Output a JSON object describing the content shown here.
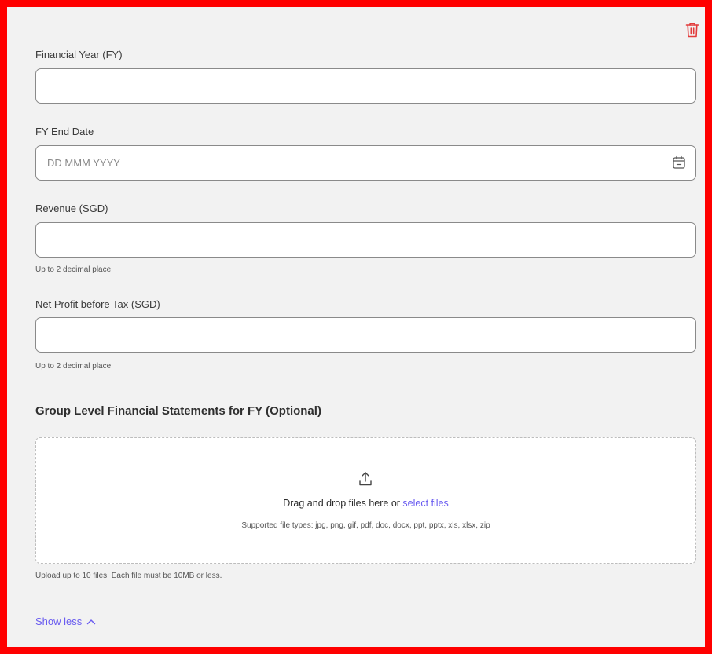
{
  "form": {
    "financial_year": {
      "label": "Financial Year (FY)",
      "value": "",
      "placeholder": ""
    },
    "fy_end_date": {
      "label": "FY End Date",
      "value": "",
      "placeholder": "DD MMM YYYY"
    },
    "revenue": {
      "label": "Revenue (SGD)",
      "value": "",
      "placeholder": "",
      "helper": "Up to 2 decimal place"
    },
    "net_profit": {
      "label": "Net Profit before Tax (SGD)",
      "value": "",
      "placeholder": "",
      "helper": "Up to 2 decimal place"
    }
  },
  "upload": {
    "section_title": "Group Level Financial Statements for FY (Optional)",
    "drop_text": "Drag and drop files here or ",
    "select_link": "select files",
    "supported_types": "Supported file types: jpg, png, gif, pdf, doc, docx, ppt, pptx, xls, xlsx, zip",
    "limit_note": "Upload up to 10 files. Each file must be 10MB or less."
  },
  "toggle": {
    "label": "Show less"
  },
  "icons": {
    "delete": "trash-icon",
    "calendar": "calendar-icon",
    "upload": "upload-icon",
    "toggle": "chevron-up-icon"
  },
  "colors": {
    "frame_border": "#ff0000",
    "link": "#6a5cf0",
    "delete_icon": "#e23b3b",
    "background": "#f2f2f2"
  }
}
